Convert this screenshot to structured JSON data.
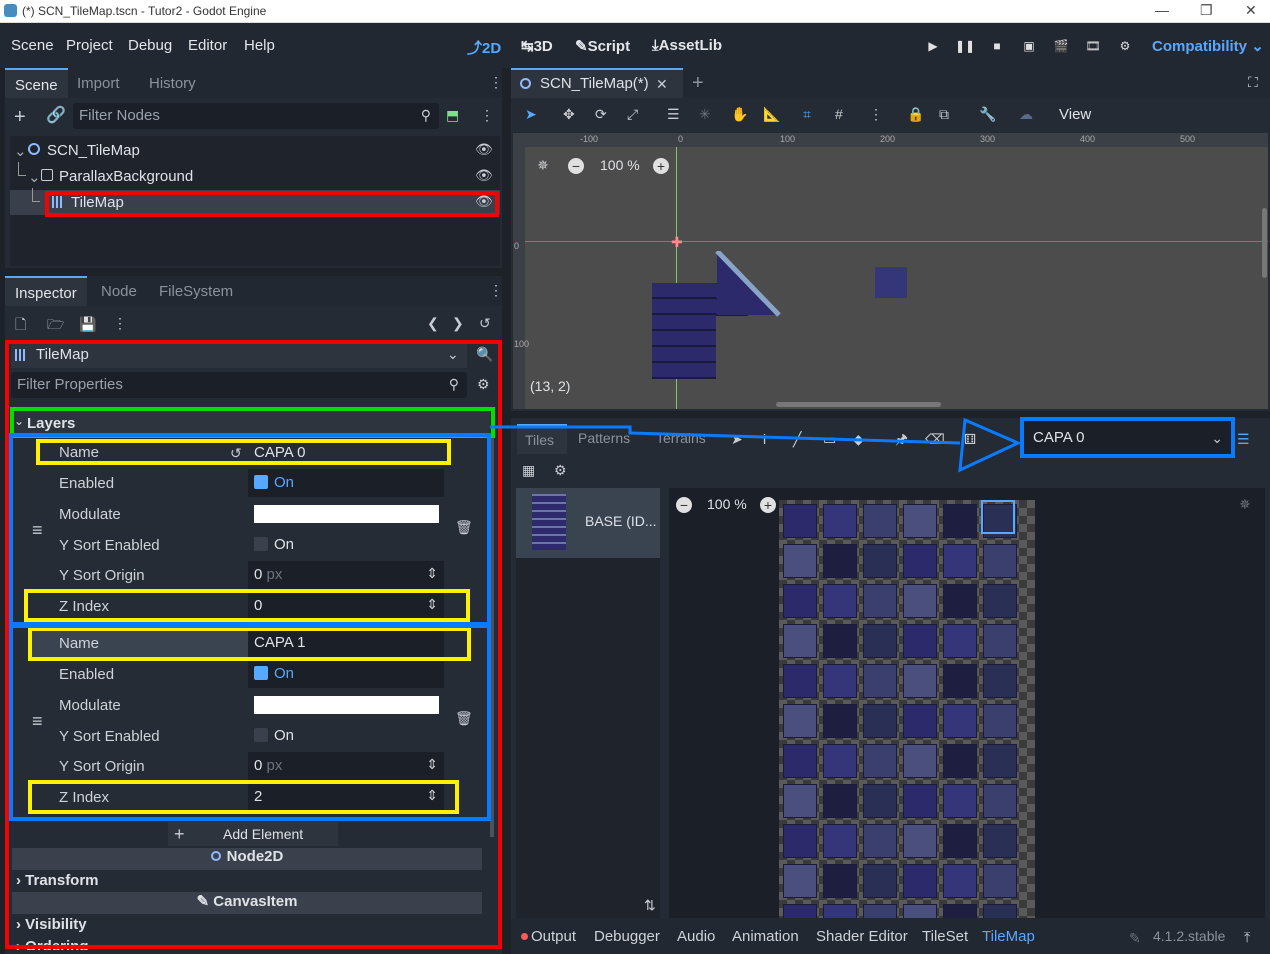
{
  "window": {
    "title": "(*) SCN_TileMap.tscn - Tutor2 - Godot Engine"
  },
  "menu": [
    "Scene",
    "Project",
    "Debug",
    "Editor",
    "Help"
  ],
  "workspaces": {
    "w2d": "2D",
    "w3d": "3D",
    "script": "Script",
    "assetlib": "AssetLib"
  },
  "renderer": "Compatibility",
  "scene_dock": {
    "tabs": [
      "Scene",
      "Import",
      "History"
    ],
    "filter_placeholder": "Filter Nodes",
    "tree": [
      "SCN_TileMap",
      "ParallaxBackground",
      "TileMap"
    ]
  },
  "inspector_dock": {
    "tabs": [
      "Inspector",
      "Node",
      "FileSystem"
    ],
    "object": "TileMap",
    "filter_placeholder": "Filter Properties",
    "section_layers": "Layers",
    "layer0": {
      "name_label": "Name",
      "name": "CAPA 0",
      "enabled_label": "Enabled",
      "enabled": "On",
      "modulate_label": "Modulate",
      "ysort_label": "Y Sort Enabled",
      "ysort": "On",
      "yorigin_label": "Y Sort Origin",
      "yorigin": "0",
      "unit": "px",
      "zindex_label": "Z Index",
      "zindex": "0"
    },
    "layer1": {
      "name_label": "Name",
      "name": "CAPA 1",
      "enabled_label": "Enabled",
      "enabled": "On",
      "modulate_label": "Modulate",
      "ysort_label": "Y Sort Enabled",
      "ysort": "On",
      "yorigin_label": "Y Sort Origin",
      "yorigin": "0",
      "unit": "px",
      "zindex_label": "Z Index",
      "zindex": "2"
    },
    "add_element": "Add Element",
    "node2d": "Node2D",
    "transform": "Transform",
    "canvasitem": "CanvasItem",
    "visibility": "Visibility",
    "ordering": "Ordering"
  },
  "viewport": {
    "tab": "SCN_TileMap(*)",
    "view_menu": "View",
    "zoom": "100 %",
    "coords": "(13, 2)",
    "ruler_labels": [
      "-100",
      "0",
      "100",
      "200",
      "300",
      "400",
      "500"
    ],
    "vruler_labels": [
      "0",
      "100"
    ]
  },
  "tilemap_panel": {
    "tabs": [
      "Tiles",
      "Patterns",
      "Terrains"
    ],
    "layer_select": "CAPA 0",
    "source": "BASE (ID...",
    "zoom": "100 %"
  },
  "bottom": {
    "tabs": [
      "Output",
      "Debugger",
      "Audio",
      "Animation",
      "Shader Editor",
      "TileSet",
      "TileMap"
    ],
    "version": "4.1.2.stable"
  },
  "colors": {
    "accent": "#57a8ff",
    "red_highlight": "#f00300",
    "yellow_highlight": "#fff200",
    "blue_highlight": "#0a7bff",
    "green_highlight": "#00e000"
  }
}
